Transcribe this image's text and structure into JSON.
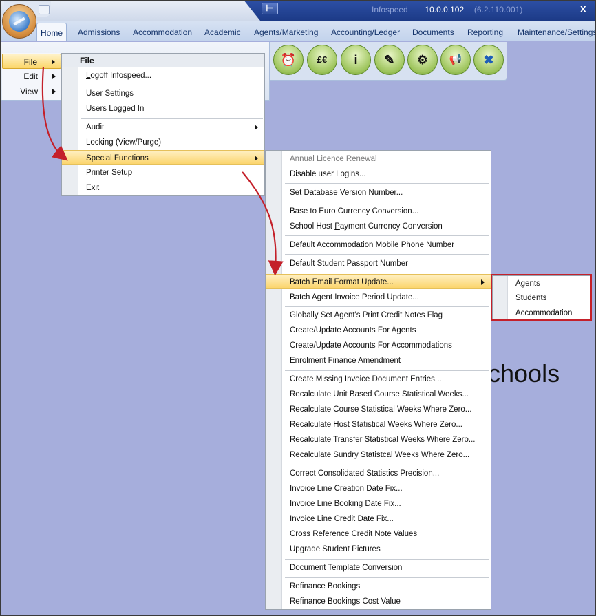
{
  "title_bar": {
    "app_name": "Infospeed",
    "version": "10.0.0.102",
    "trailing_version": "6.2.110.001",
    "close_glyph": "X",
    "pin_glyph": "⊢"
  },
  "tabs": [
    "Home",
    "Admissions",
    "Accommodation",
    "Academic",
    "Agents/Marketing",
    "Accounting/Ledger",
    "Documents",
    "Reporting",
    "Maintenance/Settings"
  ],
  "main_menu": {
    "items": [
      {
        "label": "File"
      },
      {
        "label": "Edit"
      },
      {
        "label": "View"
      }
    ]
  },
  "file_menu": {
    "header": "File",
    "items": {
      "logoff": {
        "u": "L",
        "rest": "ogoff Infospeed..."
      },
      "user_settings": "User Settings",
      "users_logged_in": "Users Logged In",
      "audit": "Audit",
      "locking": "Locking (View/Purge)",
      "special_functions": "Special Functions",
      "printer_setup": "Printer Setup",
      "exit": "Exit"
    }
  },
  "special_menu": {
    "annual_licence": "Annual Licence Renewal",
    "disable_logins": "Disable user Logins...",
    "set_db_version": "Set Database Version Number...",
    "base_to_euro": "Base to Euro Currency Conversion...",
    "school_host_payment": {
      "pre": "School Host ",
      "u": "P",
      "post": "ayment Currency Conversion"
    },
    "default_accom_phone": "Default Accommodation Mobile Phone Number",
    "default_passport": "Default Student Passport Number",
    "batch_email": "Batch Email Format Update...",
    "batch_agent_invoice": "Batch Agent Invoice Period Update...",
    "global_credit_notes": "Globally Set Agent's Print Credit Notes Flag",
    "create_accounts_agents": "Create/Update Accounts For Agents",
    "create_accounts_accom": "Create/Update Accounts For Accommodations",
    "enrolment_finance": "Enrolment Finance Amendment",
    "missing_invoice_docs": "Create Missing Invoice Document Entries...",
    "recalc_unit": "Recalculate Unit Based Course Statistical Weeks...",
    "recalc_course": "Recalculate Course Statistical Weeks Where Zero...",
    "recalc_host": "Recalculate Host Statistical Weeks Where Zero...",
    "recalc_transfer": "Recalculate Transfer Statistical Weeks Where Zero...",
    "recalc_sundry": "Recalculate Sundry Statistcal Weeks Where Zero...",
    "consolidated_precision": "Correct  Consolidated Statistics  Precision...",
    "line_creation_fix": "Invoice Line Creation Date Fix...",
    "line_booking_fix": "Invoice Line Booking Date Fix...",
    "line_credit_fix": "Invoice Line Credit Date Fix...",
    "cross_ref_credit": "Cross Reference Credit Note Values",
    "upgrade_pictures": "Upgrade Student Pictures",
    "doc_template_conv": "Document Template Conversion",
    "refinance_bookings": "Refinance Bookings",
    "refinance_cost": "Refinance Bookings Cost Value"
  },
  "batch_email_submenu": {
    "items": [
      "Agents",
      "Students",
      "Accommodation"
    ]
  },
  "background_text": "chools",
  "toolbar_icons": [
    "alarm-clock-icon",
    "currency-icon",
    "info-icon",
    "edit-document-icon",
    "settings-cogs-icon",
    "megaphone-icon",
    "cancel-x-icon"
  ],
  "toolbar_glyphs": [
    "⏰",
    "£€",
    "i",
    "✎",
    "⚙",
    "📢",
    "✖"
  ],
  "colors": {
    "highlight": "#fbd66a",
    "annotation_red": "#c4202a",
    "workspace": "#a6aedc"
  }
}
